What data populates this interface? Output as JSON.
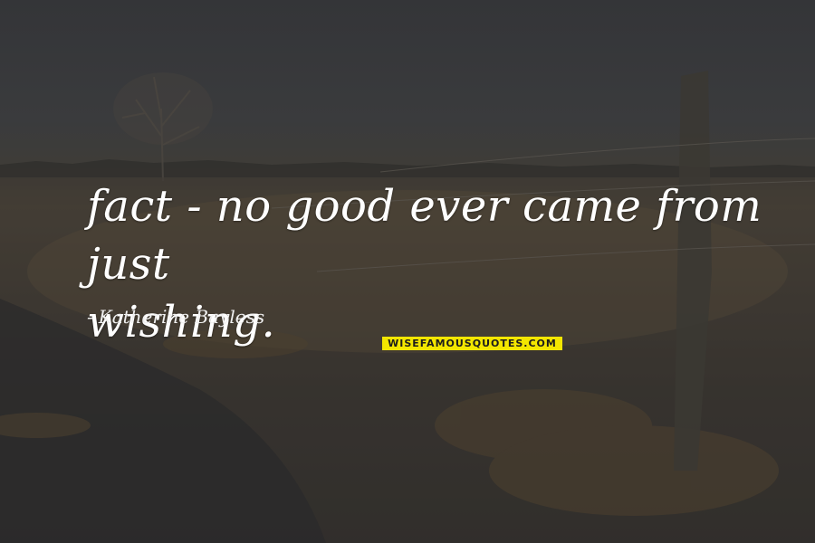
{
  "quote": {
    "text_line1": "fact - no good ever came from just",
    "text_line2": "wishing.",
    "author_dash": "-",
    "author": "Katherine Bayless"
  },
  "watermark": "WISEFAMOUSQUOTES.COM",
  "colors": {
    "text": "#ffffff",
    "watermark_bg": "#f3e600",
    "sky": "#3a3b3d",
    "field": "#3f3a33"
  }
}
